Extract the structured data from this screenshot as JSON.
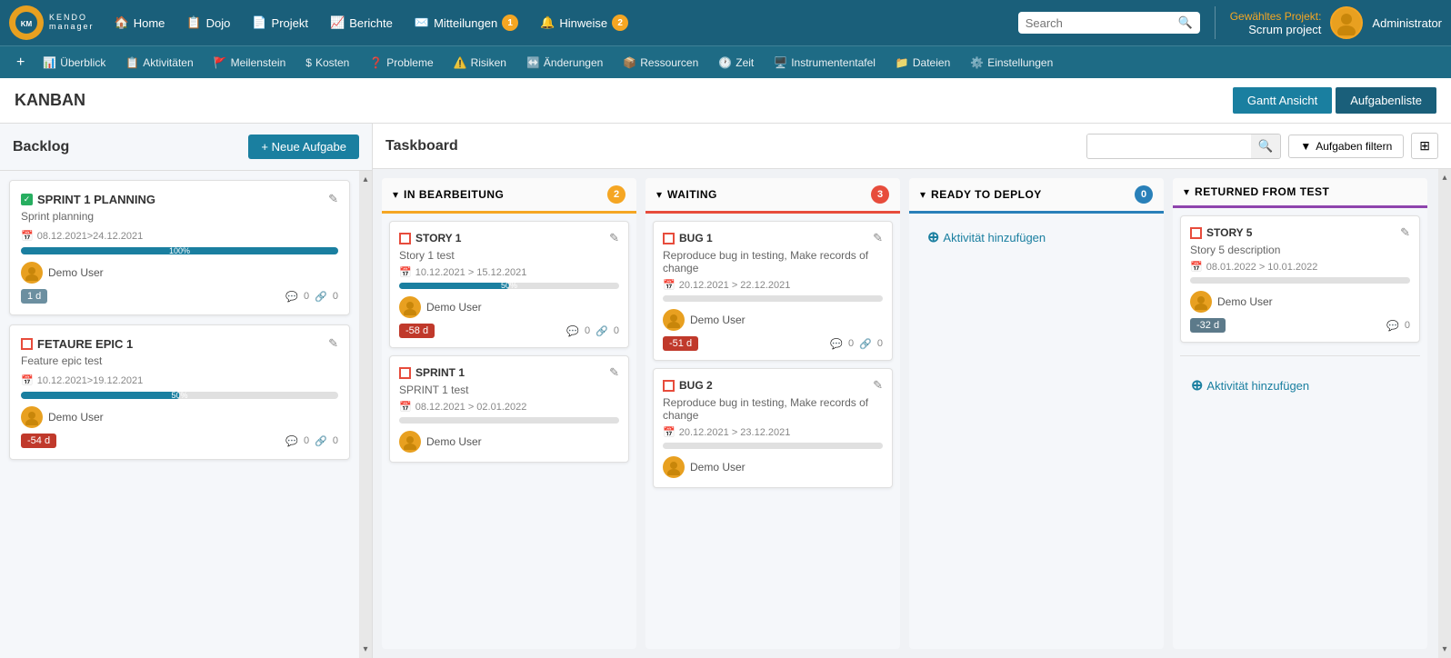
{
  "app": {
    "title": "Kendo Manager",
    "logo_line1": "KENDO",
    "logo_line2": "manager"
  },
  "topNav": {
    "items": [
      {
        "id": "home",
        "icon": "🏠",
        "label": "Home"
      },
      {
        "id": "dojo",
        "icon": "📋",
        "label": "Dojo"
      },
      {
        "id": "projekt",
        "icon": "📄",
        "label": "Projekt"
      },
      {
        "id": "berichte",
        "icon": "📈",
        "label": "Berichte"
      },
      {
        "id": "mitteilungen",
        "icon": "✉️",
        "label": "Mitteilungen",
        "badge": "1"
      },
      {
        "id": "hinweise",
        "icon": "🔔",
        "label": "Hinweise",
        "badge": "2"
      }
    ],
    "search": {
      "placeholder": "Search"
    },
    "project": {
      "label": "Gewähltes Projekt:",
      "name": "Scrum project"
    },
    "user": {
      "name": "Administrator"
    }
  },
  "secondNav": {
    "add_label": "+",
    "items": [
      {
        "id": "uberblick",
        "icon": "📊",
        "label": "Überblick"
      },
      {
        "id": "aktivitaten",
        "icon": "📋",
        "label": "Aktivitäten"
      },
      {
        "id": "meilenstein",
        "icon": "🚩",
        "label": "Meilenstein"
      },
      {
        "id": "kosten",
        "icon": "$",
        "label": "Kosten"
      },
      {
        "id": "probleme",
        "icon": "❓",
        "label": "Probleme"
      },
      {
        "id": "risiken",
        "icon": "⚠️",
        "label": "Risiken"
      },
      {
        "id": "anderungen",
        "icon": "↔️",
        "label": "Änderungen"
      },
      {
        "id": "ressourcen",
        "icon": "📦",
        "label": "Ressourcen"
      },
      {
        "id": "zeit",
        "icon": "🕐",
        "label": "Zeit"
      },
      {
        "id": "instrumententafel",
        "icon": "🖥️",
        "label": "Instrumententafel"
      },
      {
        "id": "dateien",
        "icon": "📁",
        "label": "Dateien"
      },
      {
        "id": "einstellungen",
        "icon": "⚙️",
        "label": "Einstellungen"
      }
    ]
  },
  "kanban": {
    "title": "KANBAN",
    "btn_gantt": "Gantt Ansicht",
    "btn_aufgaben": "Aufgabenliste"
  },
  "backlog": {
    "title": "Backlog",
    "btn_neue": "+ Neue Aufgabe",
    "cards": [
      {
        "id": "sprint1",
        "type": "sprint",
        "title": "SPRINT 1 PLANNING",
        "desc": "Sprint planning",
        "dates": "08.12.2021>24.12.2021",
        "progress": 100,
        "progress_label": "100%",
        "user": "Demo User",
        "time_badge": "1 d",
        "comments": "0",
        "links": "0"
      },
      {
        "id": "epic1",
        "type": "story",
        "title": "FETAURE EPIC 1",
        "desc": "Feature epic test",
        "dates": "10.12.2021>19.12.2021",
        "progress": 50,
        "progress_label": "50%",
        "user": "Demo User",
        "time_badge": "-54 d",
        "comments": "0",
        "links": "0"
      }
    ]
  },
  "taskboard": {
    "title": "Taskboard",
    "search_placeholder": "",
    "btn_filter": "Aufgaben filtern",
    "columns": [
      {
        "id": "in-bearbeitung",
        "title": "IN BEARBEITUNG",
        "border_color": "#f5a623",
        "badge_color": "#f5a623",
        "count": "2",
        "cards": [
          {
            "id": "story1",
            "type": "story",
            "title": "STORY 1",
            "desc": "Story 1 test",
            "dates": "10.12.2021 > 15.12.2021",
            "progress": 50,
            "progress_label": "50%",
            "user": "Demo User",
            "time_badge": "-58 d",
            "comments": "0",
            "links": "0"
          },
          {
            "id": "sprint1b",
            "type": "story",
            "title": "SPRINT 1",
            "desc": "SPRINT 1 test",
            "dates": "08.12.2021 > 02.01.2022",
            "progress": 0,
            "progress_label": "",
            "user": "Demo User",
            "time_badge": "",
            "comments": "",
            "links": ""
          }
        ]
      },
      {
        "id": "waiting",
        "title": "WAITING",
        "border_color": "#e74c3c",
        "badge_color": "#e74c3c",
        "count": "3",
        "cards": [
          {
            "id": "bug1",
            "type": "bug",
            "title": "BUG 1",
            "desc": "Reproduce bug in testing, Make records of change",
            "dates": "20.12.2021 > 22.12.2021",
            "progress": 0,
            "progress_label": "",
            "user": "Demo User",
            "time_badge": "-51 d",
            "comments": "0",
            "links": "0"
          },
          {
            "id": "bug2",
            "type": "bug",
            "title": "BUG 2",
            "desc": "Reproduce bug in testing, Make records of change",
            "dates": "20.12.2021 > 23.12.2021",
            "progress": 0,
            "progress_label": "",
            "user": "Demo User",
            "time_badge": "",
            "comments": "",
            "links": ""
          }
        ]
      },
      {
        "id": "ready-to-deploy",
        "title": "READY TO DEPLOY",
        "border_color": "#2980b9",
        "badge_color": "#2980b9",
        "count": "0",
        "cards": [],
        "add_activity": "Aktivität hinzufügen"
      },
      {
        "id": "returned-from-test",
        "title": "RETURNED FROM TEST",
        "border_color": "#8e44ad",
        "badge_color": "#8e44ad",
        "count": "",
        "cards": [
          {
            "id": "story5",
            "type": "story",
            "title": "STORY 5",
            "desc": "Story 5 description",
            "dates": "08.01.2022 > 10.01.2022",
            "progress": 0,
            "progress_label": "",
            "user": "Demo User",
            "time_badge": "-32 d",
            "comments": "0",
            "links": ""
          }
        ],
        "add_activity": "Aktivität hinzufügen"
      }
    ]
  },
  "icons": {
    "search": "🔍",
    "edit": "✎",
    "calendar": "📅",
    "comment": "💬",
    "link": "🔗",
    "chevron_down": "▾",
    "chevron_up": "▴",
    "plus": "+",
    "filter": "▼",
    "grid": "⊞",
    "check": "✓"
  }
}
